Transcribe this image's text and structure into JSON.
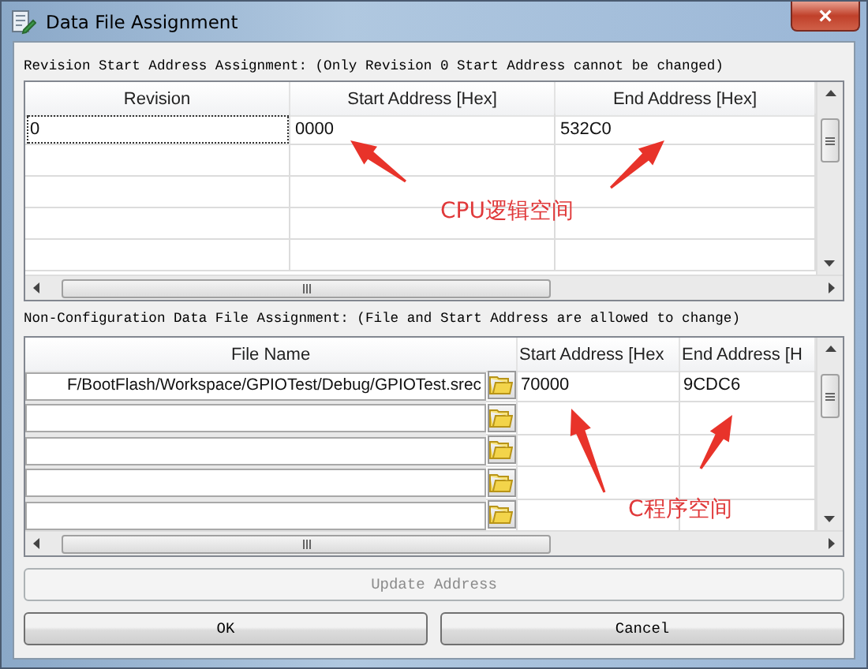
{
  "window": {
    "title": "Data File Assignment",
    "close_icon": "×"
  },
  "revision_section": {
    "label": "Revision Start Address Assignment: (Only Revision 0 Start Address cannot be changed)",
    "columns": [
      "Revision",
      "Start Address [Hex]",
      "End Address [Hex]"
    ],
    "rows": [
      {
        "revision": "0",
        "start": "0000",
        "end": "532C0",
        "focused": true
      }
    ]
  },
  "data_file_section": {
    "label": "Non-Configuration Data File Assignment:  (File and Start Address are allowed to change)",
    "columns": [
      "File Name",
      "Start Address [Hex",
      "End Address [H"
    ],
    "rows": [
      {
        "file": "F/BootFlash/Workspace/GPIOTest/Debug/GPIOTest.srec",
        "start": "70000",
        "end": "9CDC6"
      }
    ]
  },
  "update_button": {
    "label": "Update Address",
    "disabled": true
  },
  "buttons": [
    {
      "label": "OK"
    },
    {
      "label": "Cancel"
    }
  ],
  "annotations": [
    {
      "text": "CPU逻辑空间"
    },
    {
      "text": "C程序空间"
    }
  ]
}
